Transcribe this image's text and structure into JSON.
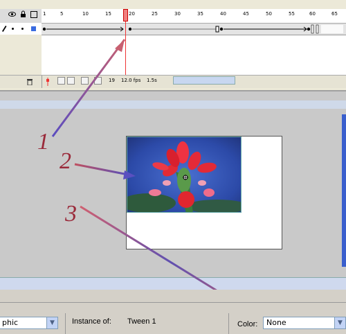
{
  "timeline": {
    "ruler_labels": [
      "1",
      "5",
      "10",
      "15",
      "20",
      "25",
      "30",
      "35",
      "40",
      "45",
      "50",
      "55",
      "60",
      "65"
    ],
    "layer_row_icons": [
      "pencil-icon",
      "dot-icon",
      "dot-icon",
      "outline-square-icon"
    ],
    "status": {
      "current_frame": "19",
      "frame_rate": "12.0 fps",
      "elapsed_time": "1.5s"
    }
  },
  "annotations": {
    "label_1": "1",
    "label_2": "2",
    "label_3": "3",
    "arrow_color": "#c05060"
  },
  "properties": {
    "symbol_type_value": "phic",
    "instance_of_label": "Instance of:",
    "instance_of_value": "Tween 1",
    "color_label": "Color:",
    "color_value": "None"
  },
  "colors": {
    "playhead": "#e33333",
    "stage_bg": "#c9c9c9",
    "scrollbar_blue": "#3a5fcd"
  }
}
